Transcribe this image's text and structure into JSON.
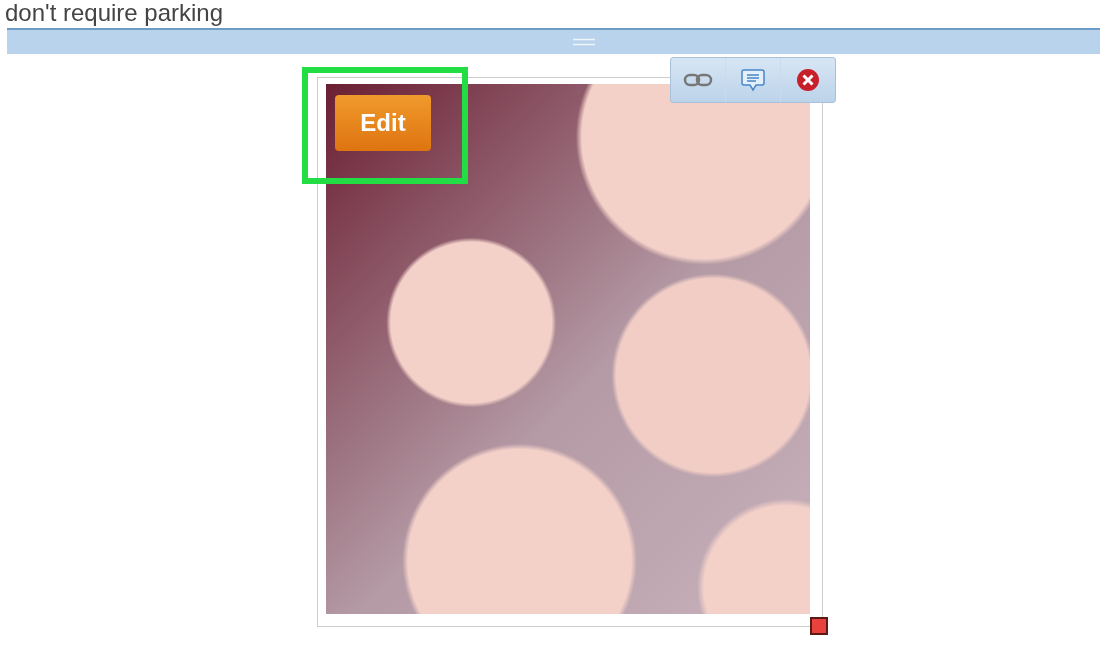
{
  "body_text": "don't require parking",
  "image_editor": {
    "edit_button": "Edit",
    "highlighted": true,
    "toolbar": [
      {
        "kind": "link"
      },
      {
        "kind": "caption"
      },
      {
        "kind": "remove"
      }
    ]
  }
}
